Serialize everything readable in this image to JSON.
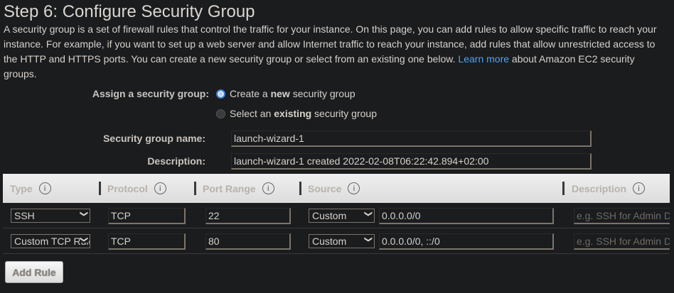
{
  "title": "Step 6: Configure Security Group",
  "intro": {
    "text": "A security group is a set of firewall rules that control the traffic for your instance. On this page, you can add rules to allow specific traffic to reach your instance. For example, if you want to set up a web server and allow Internet traffic to reach your instance, add rules that allow unrestricted access to the HTTP and HTTPS ports. You can create a new security group or select from an existing one below.",
    "link": "Learn more",
    "after": "about Amazon EC2 security groups."
  },
  "assign": {
    "label": "Assign a security group:",
    "options": [
      {
        "pre": "Create a ",
        "bold": "new",
        "post": " security group",
        "selected": true
      },
      {
        "pre": "Select an ",
        "bold": "existing",
        "post": " security group",
        "selected": false
      }
    ]
  },
  "name": {
    "label": "Security group name:",
    "value": "launch-wizard-1"
  },
  "description": {
    "label": "Description:",
    "value": "launch-wizard-1 created 2022-02-08T06:22:42.894+02:00"
  },
  "table": {
    "headers": [
      "Type",
      "Protocol",
      "Port Range",
      "Source",
      "Description"
    ],
    "rows": [
      {
        "type": "SSH",
        "protocol": "TCP",
        "port": "22",
        "source_type": "Custom",
        "source": "0.0.0.0/0",
        "description_placeholder": "e.g. SSH for Admin Desktop"
      },
      {
        "type": "Custom TCP Rule",
        "protocol": "TCP",
        "port": "80",
        "source_type": "Custom",
        "source": "0.0.0.0/0, ::/0",
        "description_placeholder": "e.g. SSH for Admin Desktop"
      }
    ]
  },
  "add_rule": "Add Rule"
}
